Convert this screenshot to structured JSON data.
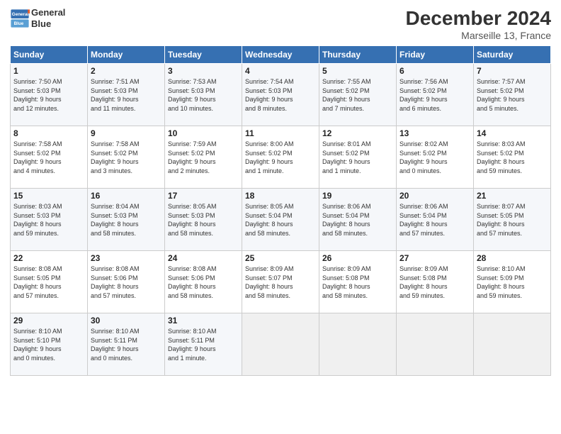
{
  "header": {
    "logo_text_line1": "General",
    "logo_text_line2": "Blue",
    "month": "December 2024",
    "location": "Marseille 13, France"
  },
  "weekdays": [
    "Sunday",
    "Monday",
    "Tuesday",
    "Wednesday",
    "Thursday",
    "Friday",
    "Saturday"
  ],
  "weeks": [
    [
      {
        "day": "1",
        "info": "Sunrise: 7:50 AM\nSunset: 5:03 PM\nDaylight: 9 hours\nand 12 minutes."
      },
      {
        "day": "2",
        "info": "Sunrise: 7:51 AM\nSunset: 5:03 PM\nDaylight: 9 hours\nand 11 minutes."
      },
      {
        "day": "3",
        "info": "Sunrise: 7:53 AM\nSunset: 5:03 PM\nDaylight: 9 hours\nand 10 minutes."
      },
      {
        "day": "4",
        "info": "Sunrise: 7:54 AM\nSunset: 5:03 PM\nDaylight: 9 hours\nand 8 minutes."
      },
      {
        "day": "5",
        "info": "Sunrise: 7:55 AM\nSunset: 5:02 PM\nDaylight: 9 hours\nand 7 minutes."
      },
      {
        "day": "6",
        "info": "Sunrise: 7:56 AM\nSunset: 5:02 PM\nDaylight: 9 hours\nand 6 minutes."
      },
      {
        "day": "7",
        "info": "Sunrise: 7:57 AM\nSunset: 5:02 PM\nDaylight: 9 hours\nand 5 minutes."
      }
    ],
    [
      {
        "day": "8",
        "info": "Sunrise: 7:58 AM\nSunset: 5:02 PM\nDaylight: 9 hours\nand 4 minutes."
      },
      {
        "day": "9",
        "info": "Sunrise: 7:58 AM\nSunset: 5:02 PM\nDaylight: 9 hours\nand 3 minutes."
      },
      {
        "day": "10",
        "info": "Sunrise: 7:59 AM\nSunset: 5:02 PM\nDaylight: 9 hours\nand 2 minutes."
      },
      {
        "day": "11",
        "info": "Sunrise: 8:00 AM\nSunset: 5:02 PM\nDaylight: 9 hours\nand 1 minute."
      },
      {
        "day": "12",
        "info": "Sunrise: 8:01 AM\nSunset: 5:02 PM\nDaylight: 9 hours\nand 1 minute."
      },
      {
        "day": "13",
        "info": "Sunrise: 8:02 AM\nSunset: 5:02 PM\nDaylight: 9 hours\nand 0 minutes."
      },
      {
        "day": "14",
        "info": "Sunrise: 8:03 AM\nSunset: 5:02 PM\nDaylight: 8 hours\nand 59 minutes."
      }
    ],
    [
      {
        "day": "15",
        "info": "Sunrise: 8:03 AM\nSunset: 5:03 PM\nDaylight: 8 hours\nand 59 minutes."
      },
      {
        "day": "16",
        "info": "Sunrise: 8:04 AM\nSunset: 5:03 PM\nDaylight: 8 hours\nand 58 minutes."
      },
      {
        "day": "17",
        "info": "Sunrise: 8:05 AM\nSunset: 5:03 PM\nDaylight: 8 hours\nand 58 minutes."
      },
      {
        "day": "18",
        "info": "Sunrise: 8:05 AM\nSunset: 5:04 PM\nDaylight: 8 hours\nand 58 minutes."
      },
      {
        "day": "19",
        "info": "Sunrise: 8:06 AM\nSunset: 5:04 PM\nDaylight: 8 hours\nand 58 minutes."
      },
      {
        "day": "20",
        "info": "Sunrise: 8:06 AM\nSunset: 5:04 PM\nDaylight: 8 hours\nand 57 minutes."
      },
      {
        "day": "21",
        "info": "Sunrise: 8:07 AM\nSunset: 5:05 PM\nDaylight: 8 hours\nand 57 minutes."
      }
    ],
    [
      {
        "day": "22",
        "info": "Sunrise: 8:08 AM\nSunset: 5:05 PM\nDaylight: 8 hours\nand 57 minutes."
      },
      {
        "day": "23",
        "info": "Sunrise: 8:08 AM\nSunset: 5:06 PM\nDaylight: 8 hours\nand 57 minutes."
      },
      {
        "day": "24",
        "info": "Sunrise: 8:08 AM\nSunset: 5:06 PM\nDaylight: 8 hours\nand 58 minutes."
      },
      {
        "day": "25",
        "info": "Sunrise: 8:09 AM\nSunset: 5:07 PM\nDaylight: 8 hours\nand 58 minutes."
      },
      {
        "day": "26",
        "info": "Sunrise: 8:09 AM\nSunset: 5:08 PM\nDaylight: 8 hours\nand 58 minutes."
      },
      {
        "day": "27",
        "info": "Sunrise: 8:09 AM\nSunset: 5:08 PM\nDaylight: 8 hours\nand 59 minutes."
      },
      {
        "day": "28",
        "info": "Sunrise: 8:10 AM\nSunset: 5:09 PM\nDaylight: 8 hours\nand 59 minutes."
      }
    ],
    [
      {
        "day": "29",
        "info": "Sunrise: 8:10 AM\nSunset: 5:10 PM\nDaylight: 9 hours\nand 0 minutes."
      },
      {
        "day": "30",
        "info": "Sunrise: 8:10 AM\nSunset: 5:11 PM\nDaylight: 9 hours\nand 0 minutes."
      },
      {
        "day": "31",
        "info": "Sunrise: 8:10 AM\nSunset: 5:11 PM\nDaylight: 9 hours\nand 1 minute."
      },
      null,
      null,
      null,
      null
    ]
  ]
}
